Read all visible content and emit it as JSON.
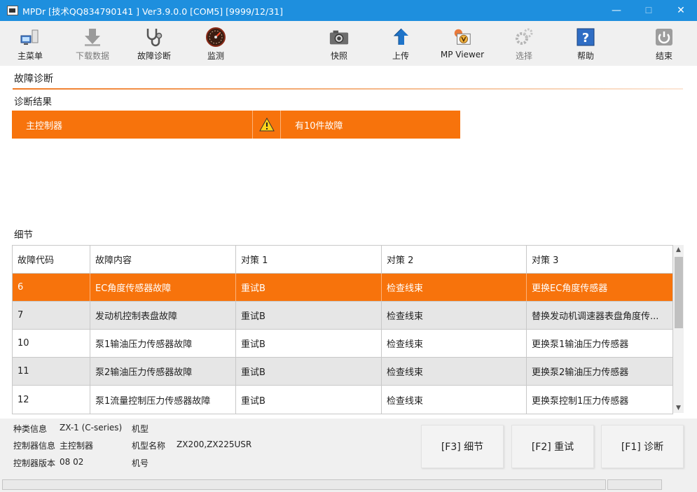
{
  "window": {
    "title": "MPDr [技术QQ834790141 ] Ver3.9.0.0 [COM5] [9999/12/31]",
    "minimize": "—",
    "maximize": "☐",
    "close": "✕"
  },
  "toolbar": {
    "main_menu": "主菜单",
    "download": "下载数据",
    "diagnosis": "故障诊断",
    "monitor": "监测",
    "snapshot": "快照",
    "upload": "上传",
    "mp_viewer": "MP Viewer",
    "select": "选择",
    "help": "帮助",
    "exit": "结束"
  },
  "main": {
    "title": "故障诊断",
    "result_label": "诊断结果",
    "result": {
      "controller": "主控制器",
      "summary": "有10件故障"
    },
    "detail_label": "细节"
  },
  "table": {
    "headers": [
      "故障代码",
      "故障内容",
      "对策 1",
      "对策 2",
      "对策 3"
    ],
    "rows": [
      [
        "6",
        "EC角度传感器故障",
        "重试B",
        "检查线束",
        "更换EC角度传感器"
      ],
      [
        "7",
        "发动机控制表盘故障",
        "重试B",
        "检查线束",
        "替换发动机调速器表盘角度传..."
      ],
      [
        "10",
        "泵1输油压力传感器故障",
        "重试B",
        "检查线束",
        "更换泵1输油压力传感器"
      ],
      [
        "11",
        "泵2输油压力传感器故障",
        "重试B",
        "检查线束",
        "更换泵2输油压力传感器"
      ],
      [
        "12",
        "泵1流量控制压力传感器故障",
        "重试B",
        "检查线束",
        "更换泵控制1压力传感器"
      ]
    ]
  },
  "info": {
    "type_label": "种类信息",
    "type_value": "ZX-1 (C-series)",
    "model_label": "机型",
    "controller_info_label": "控制器信息",
    "controller_info_value": "主控制器",
    "model_name_label": "机型名称",
    "model_name_value": "ZX200,ZX225USR",
    "controller_version_label": "控制器版本",
    "controller_version_value": "08 02",
    "serial_label": "机号"
  },
  "buttons": {
    "f3": "[F3] 细节",
    "f2": "[F2] 重试",
    "f1": "[F1] 诊断"
  },
  "colors": {
    "titlebar": "#1e8fde",
    "accent_orange": "#f7730c",
    "row_alt": "#e6e6e6"
  }
}
